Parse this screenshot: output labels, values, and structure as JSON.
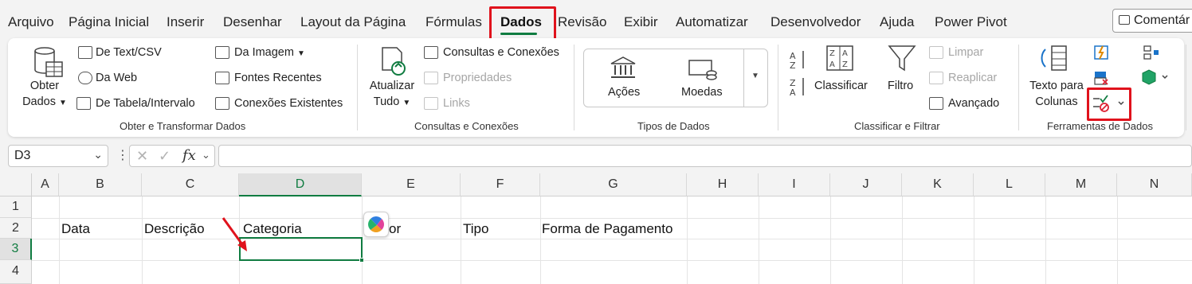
{
  "tabs": [
    {
      "label": "Arquivo"
    },
    {
      "label": "Página Inicial"
    },
    {
      "label": "Inserir"
    },
    {
      "label": "Desenhar"
    },
    {
      "label": "Layout da Página"
    },
    {
      "label": "Fórmulas"
    },
    {
      "label": "Dados",
      "active": true
    },
    {
      "label": "Revisão"
    },
    {
      "label": "Exibir"
    },
    {
      "label": "Automatizar"
    },
    {
      "label": "Desenvolvedor"
    },
    {
      "label": "Ajuda"
    },
    {
      "label": "Power Pivot"
    }
  ],
  "comment_button": "Comentár",
  "ribbon": {
    "get_data": {
      "obter_dados_line1": "Obter",
      "obter_dados_line2": "Dados",
      "from_text_csv": "De Text/CSV",
      "from_web": "Da Web",
      "from_table": "De Tabela/Intervalo",
      "from_image": "Da Imagem",
      "recent_sources": "Fontes Recentes",
      "existing_connections": "Conexões Existentes",
      "group_label": "Obter e Transformar Dados"
    },
    "queries": {
      "refresh_line1": "Atualizar",
      "refresh_line2": "Tudo",
      "queries_connections": "Consultas e Conexões",
      "properties": "Propriedades",
      "links": "Links",
      "group_label": "Consultas e Conexões"
    },
    "data_types": {
      "stocks": "Ações",
      "currencies": "Moedas",
      "group_label": "Tipos de Dados"
    },
    "sort_filter": {
      "sort": "Classificar",
      "filter": "Filtro",
      "clear": "Limpar",
      "reapply": "Reaplicar",
      "advanced": "Avançado",
      "group_label": "Classificar e Filtrar"
    },
    "data_tools": {
      "text_to_columns_line1": "Texto para",
      "text_to_columns_line2": "Colunas",
      "group_label": "Ferramentas de Dados"
    }
  },
  "formula_bar": {
    "name_box": "D3",
    "fx_label": "fx",
    "formula": ""
  },
  "grid": {
    "columns": [
      "A",
      "B",
      "C",
      "D",
      "E",
      "F",
      "G",
      "H",
      "I",
      "J",
      "K",
      "L",
      "M",
      "N"
    ],
    "rows": [
      "1",
      "2",
      "3",
      "4"
    ],
    "row2": {
      "B": "Data",
      "C": "Descrição",
      "D": "Categoria",
      "E": "or",
      "F": "Tipo",
      "G": "Forma de Pagamento"
    }
  },
  "colors": {
    "accent_green": "#107c41",
    "highlight_red": "#e0121c"
  }
}
